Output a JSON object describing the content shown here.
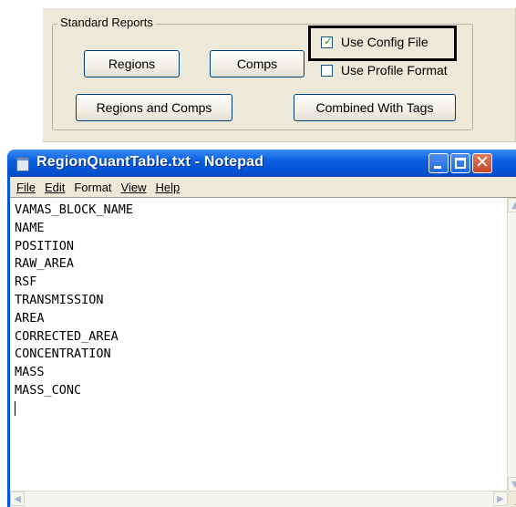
{
  "dialog": {
    "group_title": "Standard Reports",
    "buttons": {
      "regions": "Regions",
      "comps": "Comps",
      "regions_and_comps": "Regions and Comps",
      "combined_with_tags": "Combined With Tags"
    },
    "checkboxes": {
      "use_config_file": {
        "label": "Use Config File",
        "checked": true
      },
      "use_profile_format": {
        "label": "Use Profile Format",
        "checked": false
      }
    }
  },
  "notepad": {
    "title": "RegionQuantTable.txt - Notepad",
    "menu": [
      "File",
      "Edit",
      "Format",
      "View",
      "Help"
    ],
    "lines": [
      "VAMAS_BLOCK_NAME",
      "NAME",
      "POSITION",
      "RAW_AREA",
      "RSF",
      "TRANSMISSION",
      "AREA",
      "CORRECTED_AREA",
      "CONCENTRATION",
      "MASS",
      "MASS_CONC"
    ]
  },
  "colors": {
    "dialog_bg": "#ece9d8",
    "titlebar_blue": "#0a5fe0",
    "checkmark_green": "#21a121"
  }
}
